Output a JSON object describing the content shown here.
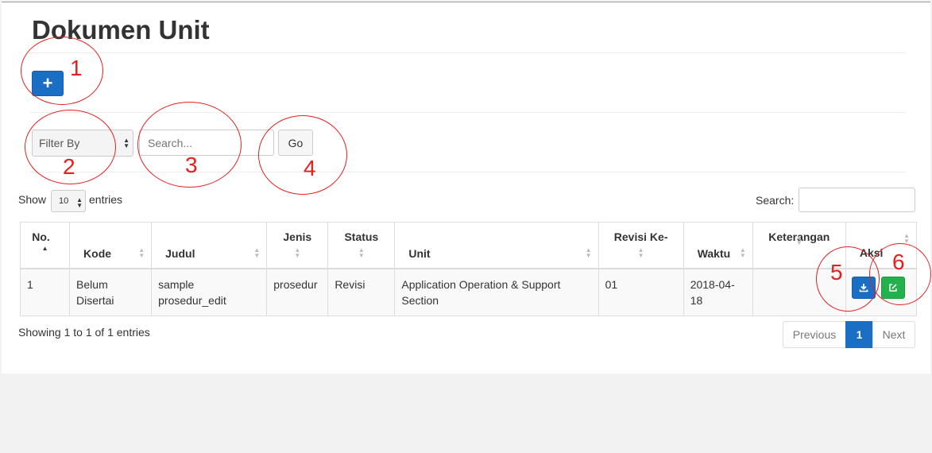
{
  "page": {
    "title": "Dokumen Unit"
  },
  "toolbar": {
    "add_label": "+"
  },
  "filter": {
    "filter_by_label": "Filter By",
    "search_placeholder": "Search...",
    "go_label": "Go"
  },
  "datatable": {
    "show_label": "Show",
    "entries_value": "10",
    "entries_label": "entries",
    "search_label": "Search:",
    "columns": [
      "No.",
      "Kode",
      "Judul",
      "Jenis",
      "Status",
      "Unit",
      "Revisi Ke-",
      "Waktu",
      "Keterangan",
      "Aksi"
    ],
    "rows": [
      {
        "no": "1",
        "kode": "Belum Disertai",
        "judul": "sample prosedur_edit",
        "jenis": "prosedur",
        "status": "Revisi",
        "unit": "Application Operation & Support Section",
        "revisi": "01",
        "waktu": "2018-04-18",
        "keterangan": ""
      }
    ],
    "info": "Showing 1 to 1 of 1 entries",
    "pagination": {
      "previous": "Previous",
      "current": "1",
      "next": "Next"
    }
  },
  "annotations": [
    "1",
    "2",
    "3",
    "4",
    "5",
    "6"
  ],
  "colors": {
    "primary": "#1a6fc4",
    "success": "#22b14c",
    "annotation": "#e61e1e"
  },
  "icons": {
    "download": "download-icon",
    "edit": "edit-icon"
  }
}
